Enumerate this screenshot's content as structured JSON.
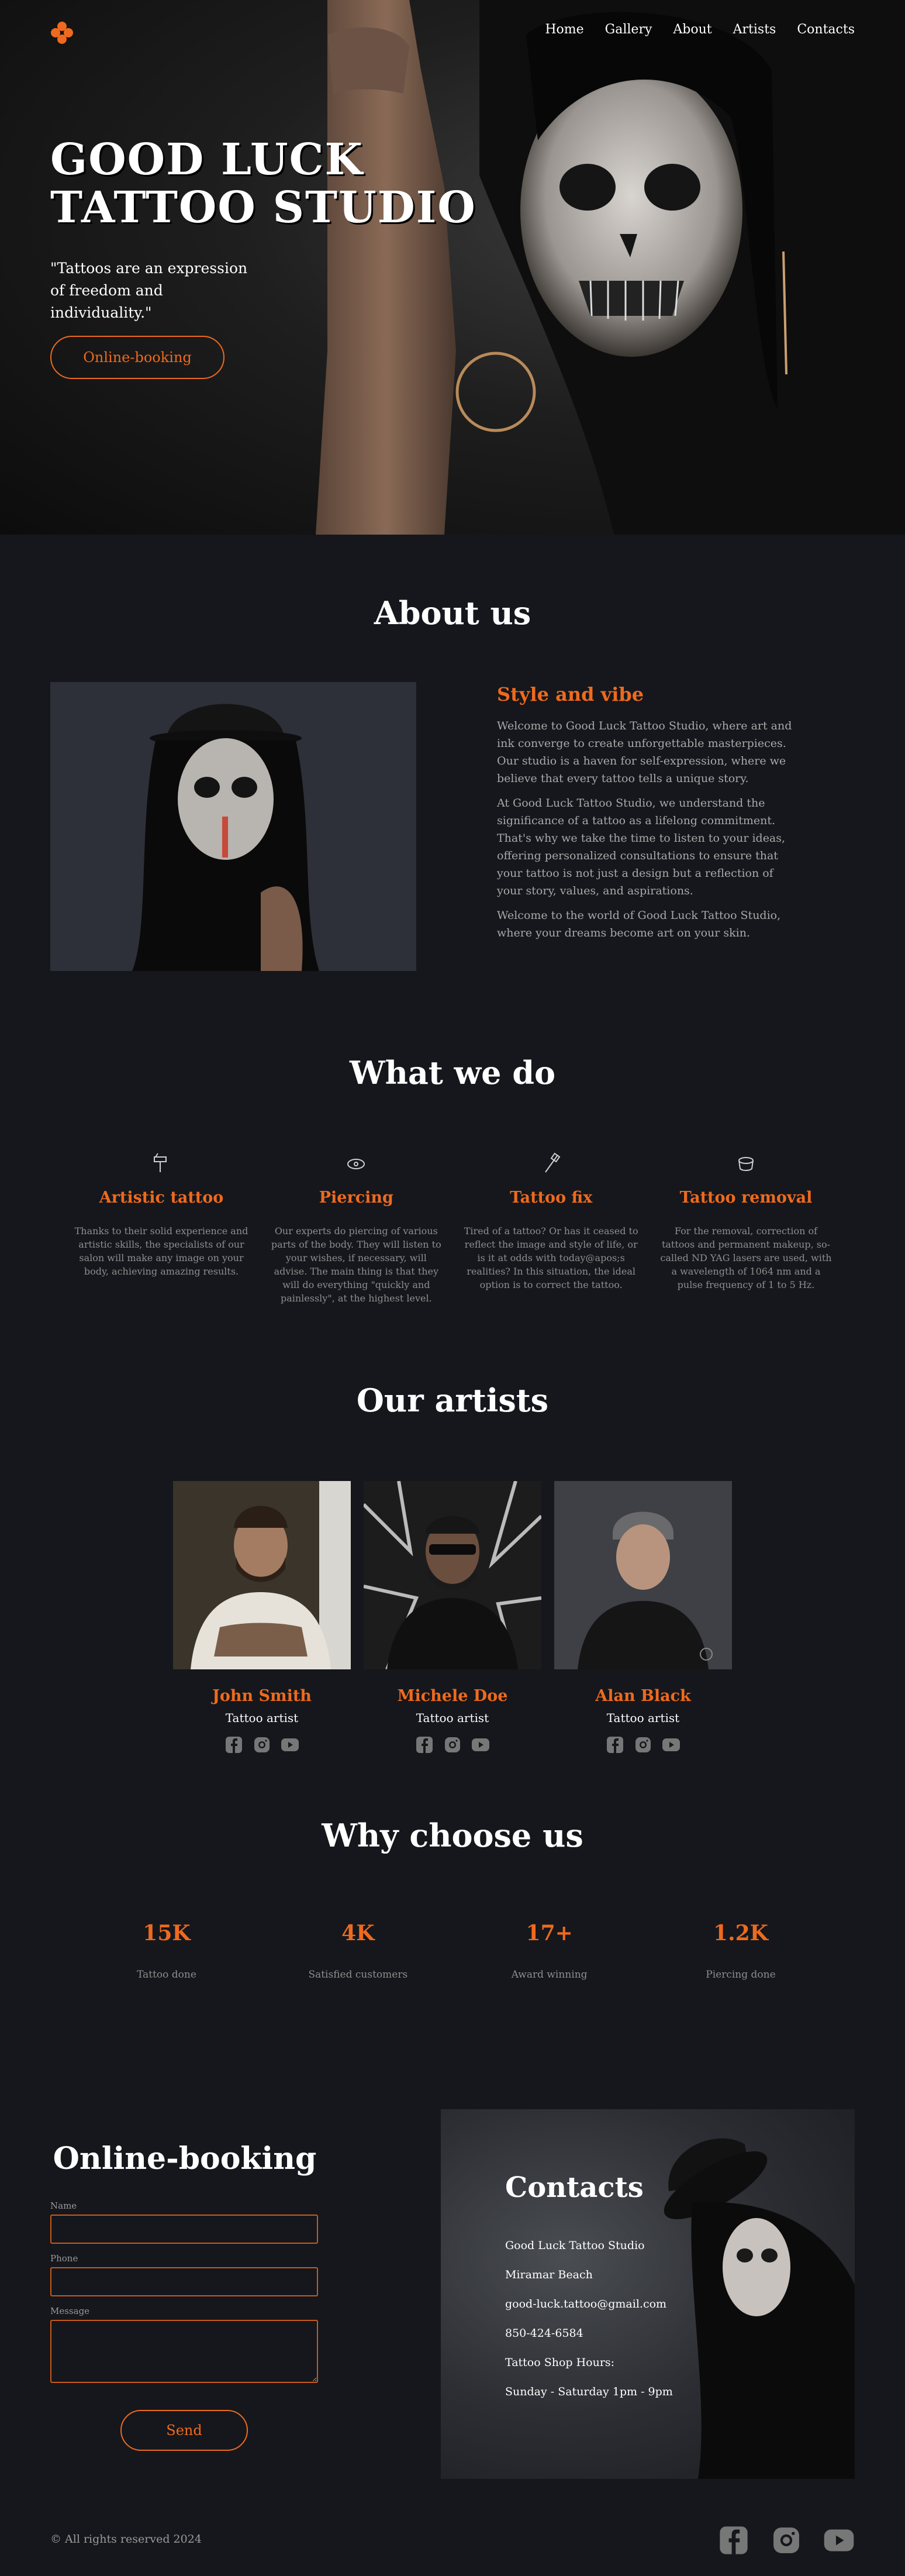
{
  "nav": {
    "items": [
      "Home",
      "Gallery",
      "About",
      "Artists",
      "Contacts"
    ]
  },
  "hero": {
    "title_line1": "GOOD LUCK",
    "title_line2": "TATTOO STUDIO",
    "quote": "\"Tattoos are an expression of freedom and individuality.\"",
    "button": "Online-booking"
  },
  "about": {
    "title": "About us",
    "subtitle": "Style and vibe",
    "paragraphs": [
      "Welcome to Good Luck Tattoo Studio, where art and ink converge to create unforgettable masterpieces. Our studio is a haven for self-expression, where we believe that every tattoo tells a unique story.",
      "At Good Luck Tattoo Studio, we understand the significance of a tattoo as a lifelong commitment. That's why we take the time to listen to your ideas, offering personalized consultations to ensure that your tattoo is not just a design but a reflection of your story, values, and aspirations.",
      "Welcome to the world of Good Luck Tattoo Studio, where your dreams become art on your skin."
    ]
  },
  "services": {
    "title": "What we do",
    "items": [
      {
        "name": "Artistic tattoo",
        "icon": "tattoo-machine-icon",
        "text": "Thanks to their solid experience and artistic skills, the specialists of our salon will make any image on your body, achieving amazing results."
      },
      {
        "name": "Piercing",
        "icon": "piercing-icon",
        "text": "Our experts do piercing of various parts of the body. They will listen to your wishes, if necessary, will advise. The main thing is that they will do everything \"quickly and painlessly\", at the highest level."
      },
      {
        "name": "Tattoo fix",
        "icon": "tattoo-pen-icon",
        "text": "Tired of a tattoo? Or has it ceased to reflect the image and style of life, or is it at odds with today@apos;s realities? In this situation, the ideal option is to correct the tattoo."
      },
      {
        "name": "Tattoo removal",
        "icon": "ink-cap-icon",
        "text": "For the removal, correction of tattoos and permanent makeup, so-called ND YAG lasers are used, with a wavelength of 1064 nm and a pulse frequency of 1 to 5 Hz."
      }
    ]
  },
  "artists": {
    "title": "Our artists",
    "items": [
      {
        "name": "John Smith",
        "role": "Tattoo artist"
      },
      {
        "name": "Michele Doe",
        "role": "Tattoo artist"
      },
      {
        "name": "Alan Black",
        "role": "Tattoo artist"
      }
    ]
  },
  "why": {
    "title": "Why choose us",
    "stats": [
      {
        "value": "15K",
        "label": "Tattoo done"
      },
      {
        "value": "4K",
        "label": "Satisfied customers"
      },
      {
        "value": "17+",
        "label": "Award winning"
      },
      {
        "value": "1.2K",
        "label": "Piercing done"
      }
    ]
  },
  "booking": {
    "title": "Online-booking",
    "name_label": "Name",
    "phone_label": "Phone",
    "message_label": "Message",
    "button": "Send"
  },
  "contacts": {
    "title": "Contacts",
    "lines": [
      "Good Luck Tattoo Studio",
      "Miramar Beach",
      "good-luck.tattoo@gmail.com",
      "850-424-6584",
      "Tattoo Shop Hours:",
      "Sunday - Saturday 1pm - 9pm"
    ]
  },
  "footer": {
    "copyright": "© All rights reserved 2024"
  },
  "colors": {
    "accent": "#ee6a1e",
    "background": "#15171c"
  }
}
